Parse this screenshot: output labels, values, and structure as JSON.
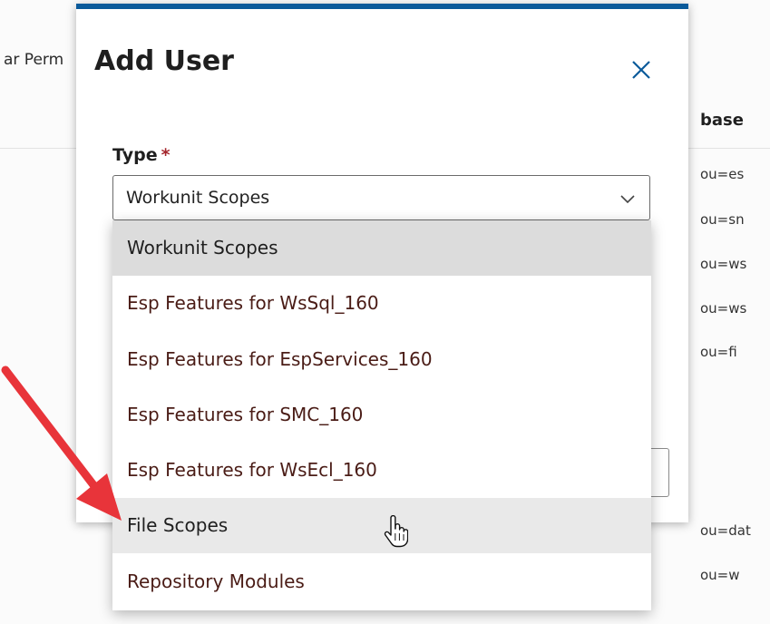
{
  "background": {
    "left_text": "ar Perm",
    "column_header": "base",
    "cells": [
      "ou=es",
      "ou=sn",
      "ou=ws",
      "ou=ws",
      "ou=fi",
      "ou=dat",
      "ou=w"
    ]
  },
  "modal": {
    "title": "Add User",
    "close_icon": "close-icon",
    "type_field": {
      "label": "Type",
      "required_marker": "*",
      "value": "Workunit Scopes",
      "icon": "chevron-down-icon"
    }
  },
  "dropdown": {
    "options": [
      {
        "label": "Workunit Scopes",
        "state": "selected"
      },
      {
        "label": "Esp Features for WsSql_160",
        "state": ""
      },
      {
        "label": "Esp Features for EspServices_160",
        "state": ""
      },
      {
        "label": "Esp Features for SMC_160",
        "state": ""
      },
      {
        "label": "Esp Features for WsEcl_160",
        "state": ""
      },
      {
        "label": "File Scopes",
        "state": "hovered"
      },
      {
        "label": "Repository Modules",
        "state": ""
      }
    ]
  },
  "colors": {
    "accent": "#0a5a9a",
    "required": "#a4262c",
    "annotation_arrow": "#e8343a"
  }
}
